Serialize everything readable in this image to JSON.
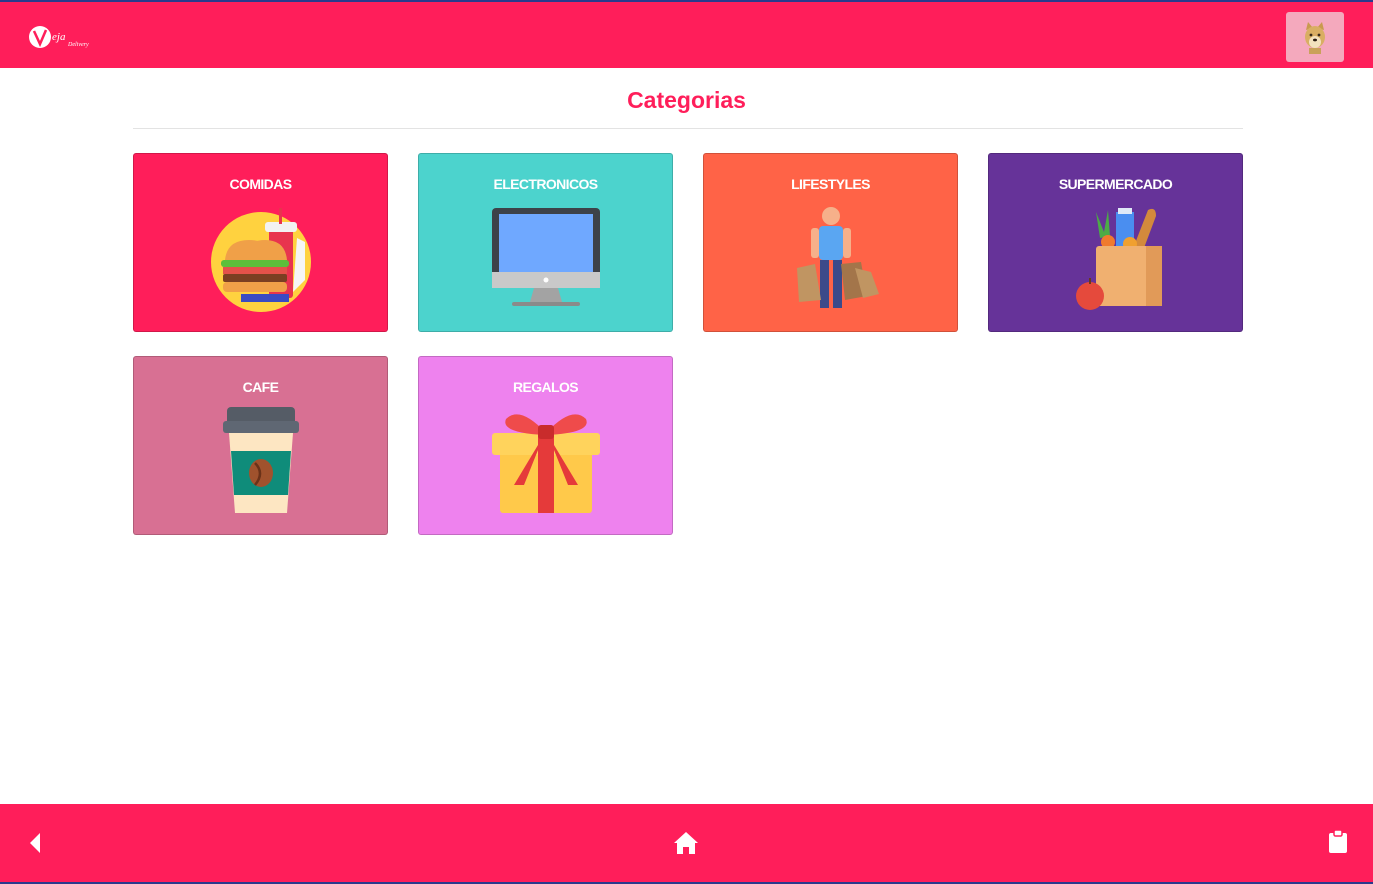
{
  "app": {
    "logo_text": "Veja",
    "logo_subtext": "Delivery",
    "brand_color": "#ff1e5a"
  },
  "header": {
    "avatar_icon": "doge-avatar-icon"
  },
  "page": {
    "title": "Categorias"
  },
  "categories": [
    {
      "label": "COMIDAS",
      "color": "#ff1e5a",
      "icon": "burger-combo-icon"
    },
    {
      "label": "ELECTRONICOS",
      "color": "#4cd3cd",
      "icon": "monitor-icon"
    },
    {
      "label": "LIFESTYLES",
      "color": "#ff6347",
      "icon": "shopper-icon"
    },
    {
      "label": "SUPERMERCADO",
      "color": "#663399",
      "icon": "grocery-bag-icon"
    },
    {
      "label": "CAFE",
      "color": "#d87093",
      "icon": "coffee-cup-icon"
    },
    {
      "label": "REGALOS",
      "color": "#ee82ee",
      "icon": "gift-box-icon"
    }
  ],
  "bottom_nav": {
    "back_icon": "back-arrow-icon",
    "home_icon": "home-icon",
    "orders_icon": "clipboard-icon"
  }
}
